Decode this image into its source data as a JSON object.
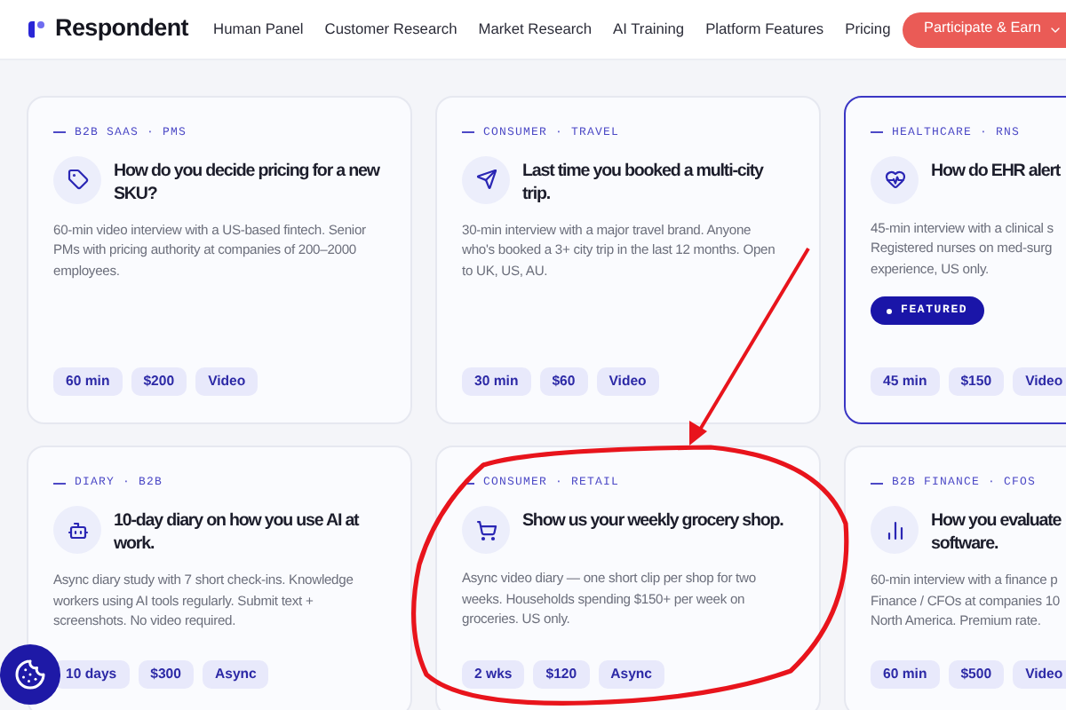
{
  "brand": {
    "name": "Respondent"
  },
  "nav": [
    "Human Panel",
    "Customer Research",
    "Market Research",
    "AI Training",
    "Platform Features",
    "Pricing"
  ],
  "cta": {
    "label": "Participate & Earn"
  },
  "cards": [
    {
      "eyebrow": "B2B SAAS · PMS",
      "title_lines": [
        "How do you decide pricing for a new",
        "SKU?"
      ],
      "description_lines": [
        "60-min video interview with a US-based fintech. Senior",
        "PMs with pricing authority at companies of 200–2000",
        "employees."
      ],
      "featured": false,
      "tags": [
        "60 min",
        "$200",
        "Video"
      ]
    },
    {
      "eyebrow": "CONSUMER · TRAVEL",
      "title_lines": [
        "Last time you booked a multi-city",
        "trip."
      ],
      "description_lines": [
        "30-min interview with a major travel brand. Anyone",
        "who's booked a 3+ city trip in the last 12 months. Open",
        "to UK, US, AU."
      ],
      "featured": false,
      "tags": [
        "30 min",
        "$60",
        "Video"
      ]
    },
    {
      "eyebrow": "HEALTHCARE · RNS",
      "title_lines": [
        "How do EHR alert"
      ],
      "description_lines": [
        "45-min interview with a clinical s",
        "Registered nurses on med-surg",
        "experience, US only."
      ],
      "featured": true,
      "badge": "FEATURED",
      "tags": [
        "45 min",
        "$150",
        "Video"
      ]
    },
    {
      "eyebrow": "DIARY · B2B",
      "title_lines": [
        "10-day diary on how you use AI at",
        "work."
      ],
      "description_lines": [
        "Async diary study with 7 short check-ins. Knowledge",
        "workers using AI tools regularly. Submit text +",
        "screenshots. No video required."
      ],
      "featured": false,
      "tags": [
        "10 days",
        "$300",
        "Async"
      ]
    },
    {
      "eyebrow": "CONSUMER · RETAIL",
      "title_lines": [
        "Show us your weekly grocery shop."
      ],
      "description_lines": [
        "Async video diary — one short clip per shop for two",
        "weeks. Households spending $150+ per week on",
        "groceries. US only."
      ],
      "featured": false,
      "tags": [
        "2 wks",
        "$120",
        "Async"
      ]
    },
    {
      "eyebrow": "B2B FINANCE · CFOS",
      "title_lines": [
        "How you evaluate",
        "software."
      ],
      "description_lines": [
        "60-min interview with a finance p",
        "Finance / CFOs at companies 10",
        "North America. Premium rate."
      ],
      "featured": false,
      "tags": [
        "60 min",
        "$500",
        "Video"
      ]
    }
  ]
}
